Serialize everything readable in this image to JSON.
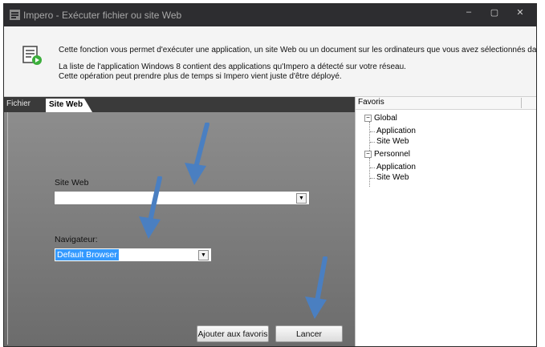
{
  "window": {
    "title": "Impero - Exécuter fichier ou site Web",
    "minimize_glyph": "–",
    "maximize_glyph": "▢",
    "close_glyph": "✕",
    "icon": "app-icon"
  },
  "info": {
    "icon": "document-run-icon",
    "line1": "Cette fonction vous permet d'exécuter une application, un site Web ou un document sur les ordinateurs que vous avez sélectionnés da...",
    "line2": "La liste de l'application Windows 8 contient des applications qu'Impero a détecté sur votre réseau.",
    "line3": "Cette opération peut prendre plus de temps si Impero vient juste d'être déployé."
  },
  "tabs": [
    {
      "label": "Fichier",
      "active": false
    },
    {
      "label": "Site Web",
      "active": true
    }
  ],
  "form": {
    "site_label": "Site Web",
    "site_value": "",
    "nav_label": "Navigateur:",
    "nav_value": "Default Browser",
    "fav_button": "Ajouter aux favoris",
    "launch_button": "Lancer",
    "dropdown_glyph": "▼"
  },
  "favoris": {
    "header": "Favoris",
    "collapse_glyph": "−",
    "groups": [
      {
        "label": "Global",
        "children": [
          "Application",
          "Site Web"
        ]
      },
      {
        "label": "Personnel",
        "children": [
          "Application",
          "Site Web"
        ]
      }
    ]
  },
  "colors": {
    "annotation_arrow": "#4a7fc1",
    "selection": "#3399ff"
  }
}
